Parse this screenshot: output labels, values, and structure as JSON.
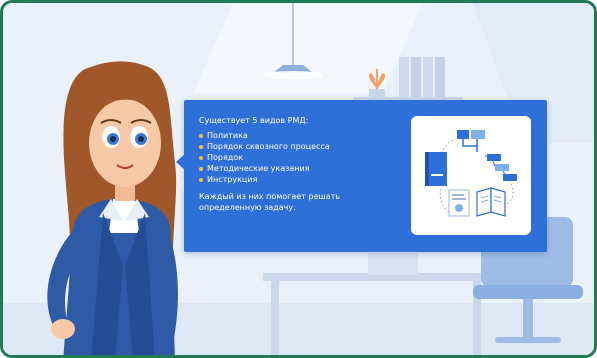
{
  "info_card": {
    "intro": "Существует 5 видов РМД:",
    "items": [
      "Политика",
      "Порядок сквозного процесса",
      "Порядок",
      "Методические указания",
      "Инструкция"
    ],
    "outro": "Каждый из них помогает решать определенную задачу."
  },
  "colors": {
    "frame_border": "#1f7a55",
    "card_background": "#2f6fd8",
    "bullet": "#f0c23a",
    "room_background": "#eaf1fa"
  },
  "icons": [
    "lamp-icon",
    "plant-icon",
    "document-icon",
    "book-icon",
    "flowchart-icon"
  ]
}
